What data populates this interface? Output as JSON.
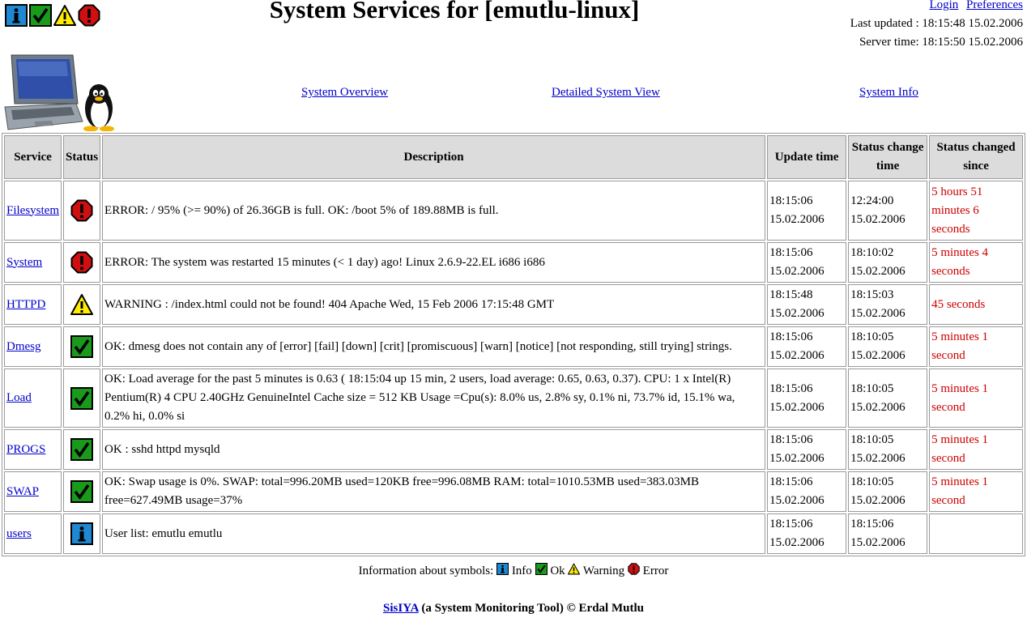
{
  "header": {
    "title": "System Services for [emutlu-linux]",
    "login": "Login",
    "preferences": "Preferences",
    "last_updated": "Last updated : 18:15:48 15.02.2006",
    "server_time": "Server time: 18:15:50 15.02.2006",
    "status_icons": [
      "info-icon",
      "ok-icon",
      "warning-icon",
      "error-icon"
    ]
  },
  "nav": {
    "overview": "System Overview",
    "detailed": "Detailed System View",
    "info": "System Info"
  },
  "table": {
    "headers": {
      "service": "Service",
      "status": "Status",
      "description": "Description",
      "update": "Update time",
      "change_line1": "Status change",
      "change_line2": "time",
      "since_line1": "Status changed",
      "since_line2": "since"
    },
    "rows": [
      {
        "service": "Filesystem",
        "status": "error",
        "description": "ERROR: / 95% (>= 90%) of 26.36GB is full. OK: /boot 5% of 189.88MB is full.",
        "update_time": "18:15:06",
        "update_date": "15.02.2006",
        "change_time": "12:24:00",
        "change_date": "15.02.2006",
        "since": "5 hours 51 minutes 6 seconds"
      },
      {
        "service": "System",
        "status": "error",
        "description": "ERROR: The system was restarted 15 minutes (< 1 day) ago! Linux 2.6.9-22.EL i686 i686",
        "update_time": "18:15:06",
        "update_date": "15.02.2006",
        "change_time": "18:10:02",
        "change_date": "15.02.2006",
        "since": "5 minutes 4 seconds"
      },
      {
        "service": "HTTPD",
        "status": "warning",
        "description": "WARNING : /index.html could not be found! 404 Apache Wed, 15 Feb 2006 17:15:48 GMT",
        "update_time": "18:15:48",
        "update_date": "15.02.2006",
        "change_time": "18:15:03",
        "change_date": "15.02.2006",
        "since": "45 seconds"
      },
      {
        "service": "Dmesg",
        "status": "ok",
        "description": "OK: dmesg does not contain any of [error] [fail] [down] [crit] [promiscuous] [warn] [notice] [not responding, still trying] strings.",
        "update_time": "18:15:06",
        "update_date": "15.02.2006",
        "change_time": "18:10:05",
        "change_date": "15.02.2006",
        "since": "5 minutes 1 second"
      },
      {
        "service": "Load",
        "status": "ok",
        "description": "OK: Load average for the past 5 minutes is 0.63 ( 18:15:04 up 15 min, 2 users, load average: 0.65, 0.63, 0.37). CPU: 1 x Intel(R) Pentium(R) 4 CPU 2.40GHz GenuineIntel Cache size = 512 KB Usage =Cpu(s): 8.0% us, 2.8% sy, 0.1% ni, 73.7% id, 15.1% wa, 0.2% hi, 0.0% si",
        "update_time": "18:15:06",
        "update_date": "15.02.2006",
        "change_time": "18:10:05",
        "change_date": "15.02.2006",
        "since": "5 minutes 1 second"
      },
      {
        "service": "PROGS",
        "status": "ok",
        "description": "OK : sshd httpd mysqld",
        "update_time": "18:15:06",
        "update_date": "15.02.2006",
        "change_time": "18:10:05",
        "change_date": "15.02.2006",
        "since": "5 minutes 1 second"
      },
      {
        "service": "SWAP",
        "status": "ok",
        "description": "OK: Swap usage is 0%. SWAP: total=996.20MB used=120KB free=996.08MB RAM: total=1010.53MB used=383.03MB free=627.49MB usage=37%",
        "update_time": "18:15:06",
        "update_date": "15.02.2006",
        "change_time": "18:10:05",
        "change_date": "15.02.2006",
        "since": "5 minutes 1 second"
      },
      {
        "service": "users",
        "status": "info",
        "description": "User list: emutlu emutlu",
        "update_time": "18:15:06",
        "update_date": "15.02.2006",
        "change_time": "18:15:06",
        "change_date": "15.02.2006",
        "since": ""
      }
    ]
  },
  "legend": {
    "prefix": "Information about symbols:",
    "info": "Info",
    "ok": "Ok",
    "warning": "Warning",
    "error": "Error"
  },
  "footer": {
    "link": "SisIYA",
    "text": " (a System Monitoring Tool) © Erdal Mutlu"
  },
  "colors": {
    "link": "#0000cc",
    "since_text": "#cc0000",
    "header_bg": "#dcdcdc",
    "info": "#1e88d2",
    "ok": "#1a9a1a",
    "warning": "#ffee00",
    "error": "#d01010"
  }
}
